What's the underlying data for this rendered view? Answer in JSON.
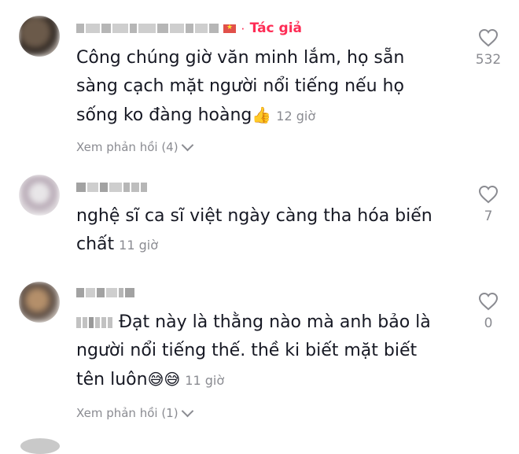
{
  "comments": [
    {
      "author_tag": "Tác giả",
      "text": "Công chúng giờ văn minh lắm, họ sẵn sàng cạch mặt người nổi tiếng nếu họ sống ko đàng hoàng",
      "emoji": "👍",
      "time": "12 giờ",
      "replies": "Xem phản hồi (4)",
      "likes": "532"
    },
    {
      "text": "nghệ sĩ ca sĩ việt ngày càng tha hóa biến chất",
      "time": "11 giờ",
      "likes": "7"
    },
    {
      "text": "Đạt này là thằng nào mà anh bảo là người nổi tiếng thế. thề ki biết mặt biết tên luôn",
      "emoji": "😅😅",
      "time": "11 giờ",
      "replies": "Xem phản hồi (1)",
      "likes": "0"
    }
  ],
  "icons": {
    "like": "heart-outline-icon",
    "expand": "chevron-down-icon",
    "flag": "vietnam-flag-icon"
  },
  "colors": {
    "accent": "#fe2c55",
    "muted": "#8a8b91",
    "text": "#161823"
  }
}
